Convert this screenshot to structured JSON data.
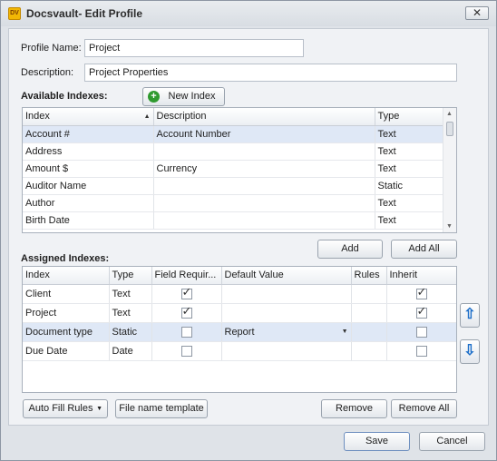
{
  "window": {
    "title": "Docsvault- Edit Profile",
    "app_icon": "docsvault-icon",
    "close_symbol": "✕"
  },
  "profile": {
    "name_label": "Profile Name:",
    "name_value": "Project",
    "description_label": "Description:",
    "description_value": "Project Properties"
  },
  "available": {
    "label": "Available Indexes:",
    "new_index_label": "New Index",
    "columns": [
      "Index",
      "Description",
      "Type"
    ],
    "rows": [
      {
        "index": "Account #",
        "description": "Account Number",
        "type": "Text"
      },
      {
        "index": "Address",
        "description": "",
        "type": "Text"
      },
      {
        "index": "Amount $",
        "description": "Currency",
        "type": "Text"
      },
      {
        "index": "Auditor Name",
        "description": "",
        "type": "Static"
      },
      {
        "index": "Author",
        "description": "",
        "type": "Text"
      },
      {
        "index": "Birth Date",
        "description": "",
        "type": "Text"
      }
    ],
    "selected_row": 0,
    "add_label": "Add",
    "add_all_label": "Add All"
  },
  "assigned": {
    "label": "Assigned Indexes:",
    "columns": [
      "Index",
      "Type",
      "Field Requir...",
      "Default Value",
      "Rules",
      "Inherit"
    ],
    "rows": [
      {
        "index": "Client",
        "type": "Text",
        "required": true,
        "default": "",
        "rules": "",
        "inherit": true
      },
      {
        "index": "Project",
        "type": "Text",
        "required": true,
        "default": "",
        "rules": "",
        "inherit": true
      },
      {
        "index": "Document type",
        "type": "Static",
        "required": false,
        "default": "Report",
        "rules": "",
        "inherit": false
      },
      {
        "index": "Due Date",
        "type": "Date",
        "required": false,
        "default": "",
        "rules": "",
        "inherit": false
      }
    ],
    "selected_row": 2
  },
  "buttons": {
    "auto_fill_rules": "Auto Fill Rules",
    "file_name_template": "File name template",
    "remove": "Remove",
    "remove_all": "Remove All",
    "save": "Save",
    "cancel": "Cancel"
  },
  "icons": {
    "move_up": "arrow-up-icon",
    "move_down": "arrow-down-icon"
  },
  "colors": {
    "accent": "#1e6fc9",
    "selected_row": "#dfe8f6",
    "new_index_icon": "#2f9a2f"
  }
}
